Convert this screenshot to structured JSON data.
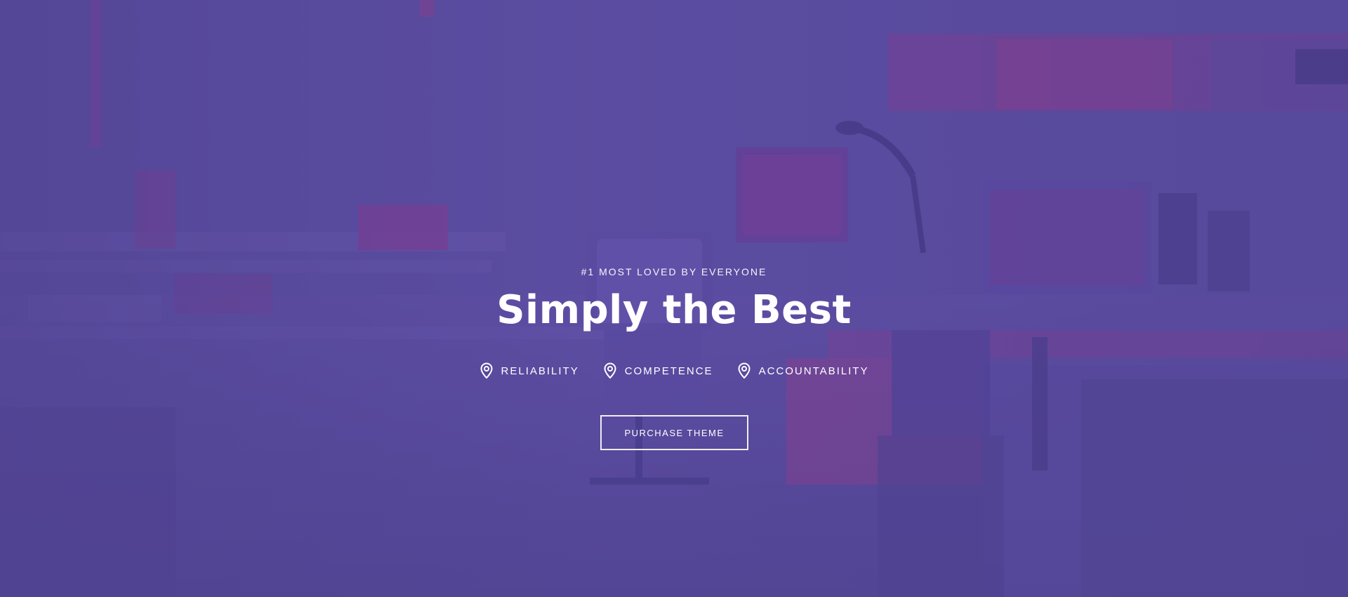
{
  "hero": {
    "eyebrow": "#1 MOST LOVED BY EVERYONE",
    "title": "Simply the Best",
    "features": [
      {
        "label": "RELIABILITY",
        "icon": "location-pin-icon"
      },
      {
        "label": "COMPETENCE",
        "icon": "location-pin-icon"
      },
      {
        "label": "ACCOUNTABILITY",
        "icon": "location-pin-icon"
      }
    ],
    "cta_label": "PURCHASE THEME"
  },
  "colors": {
    "overlay": "#5a4a9b",
    "accent_pink": "#a23b87",
    "text": "#ffffff"
  }
}
